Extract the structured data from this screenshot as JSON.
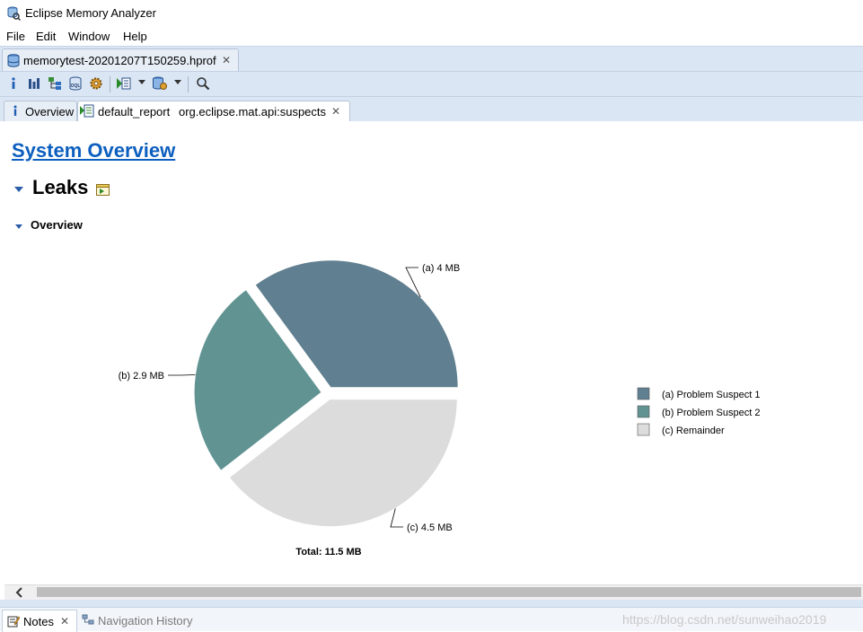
{
  "window": {
    "title": "Eclipse Memory Analyzer"
  },
  "menu": {
    "items": [
      "File",
      "Edit",
      "Window",
      "Help"
    ]
  },
  "editor_tab": {
    "label": "memorytest-20201207T150259.hprof"
  },
  "report_tabs": {
    "overview": "Overview",
    "report_name": "default_report",
    "report_id": "org.eclipse.mat.api:suspects"
  },
  "content": {
    "system_overview": "System Overview",
    "leaks_heading": "Leaks",
    "overview_heading": "Overview"
  },
  "chart_data": {
    "type": "pie",
    "slices": [
      {
        "label": "(a)",
        "value_text": "4 MB",
        "value": 4.0,
        "legend": "Problem Suspect 1",
        "color": "#607f90"
      },
      {
        "label": "(b)",
        "value_text": "2.9 MB",
        "value": 2.9,
        "legend": "Problem Suspect 2",
        "color": "#619393"
      },
      {
        "label": "(c)",
        "value_text": "4.5 MB",
        "value": 4.5,
        "legend": "Remainder",
        "color": "#dcdcdc"
      }
    ],
    "total": "Total: 11.5 MB"
  },
  "bottom": {
    "notes_tab": "Notes",
    "navigation_history_tab": "Navigation History",
    "watermark": "https://blog.csdn.net/sunweihao2019"
  },
  "icons": [
    "database-icon",
    "info-icon",
    "histogram-icon",
    "dominator-tree-icon",
    "oql-icon",
    "gear-icon",
    "run-report-icon",
    "heap-dump-icon",
    "search-icon",
    "report-icon",
    "notes-icon",
    "navigation-history-icon",
    "close-icon"
  ]
}
